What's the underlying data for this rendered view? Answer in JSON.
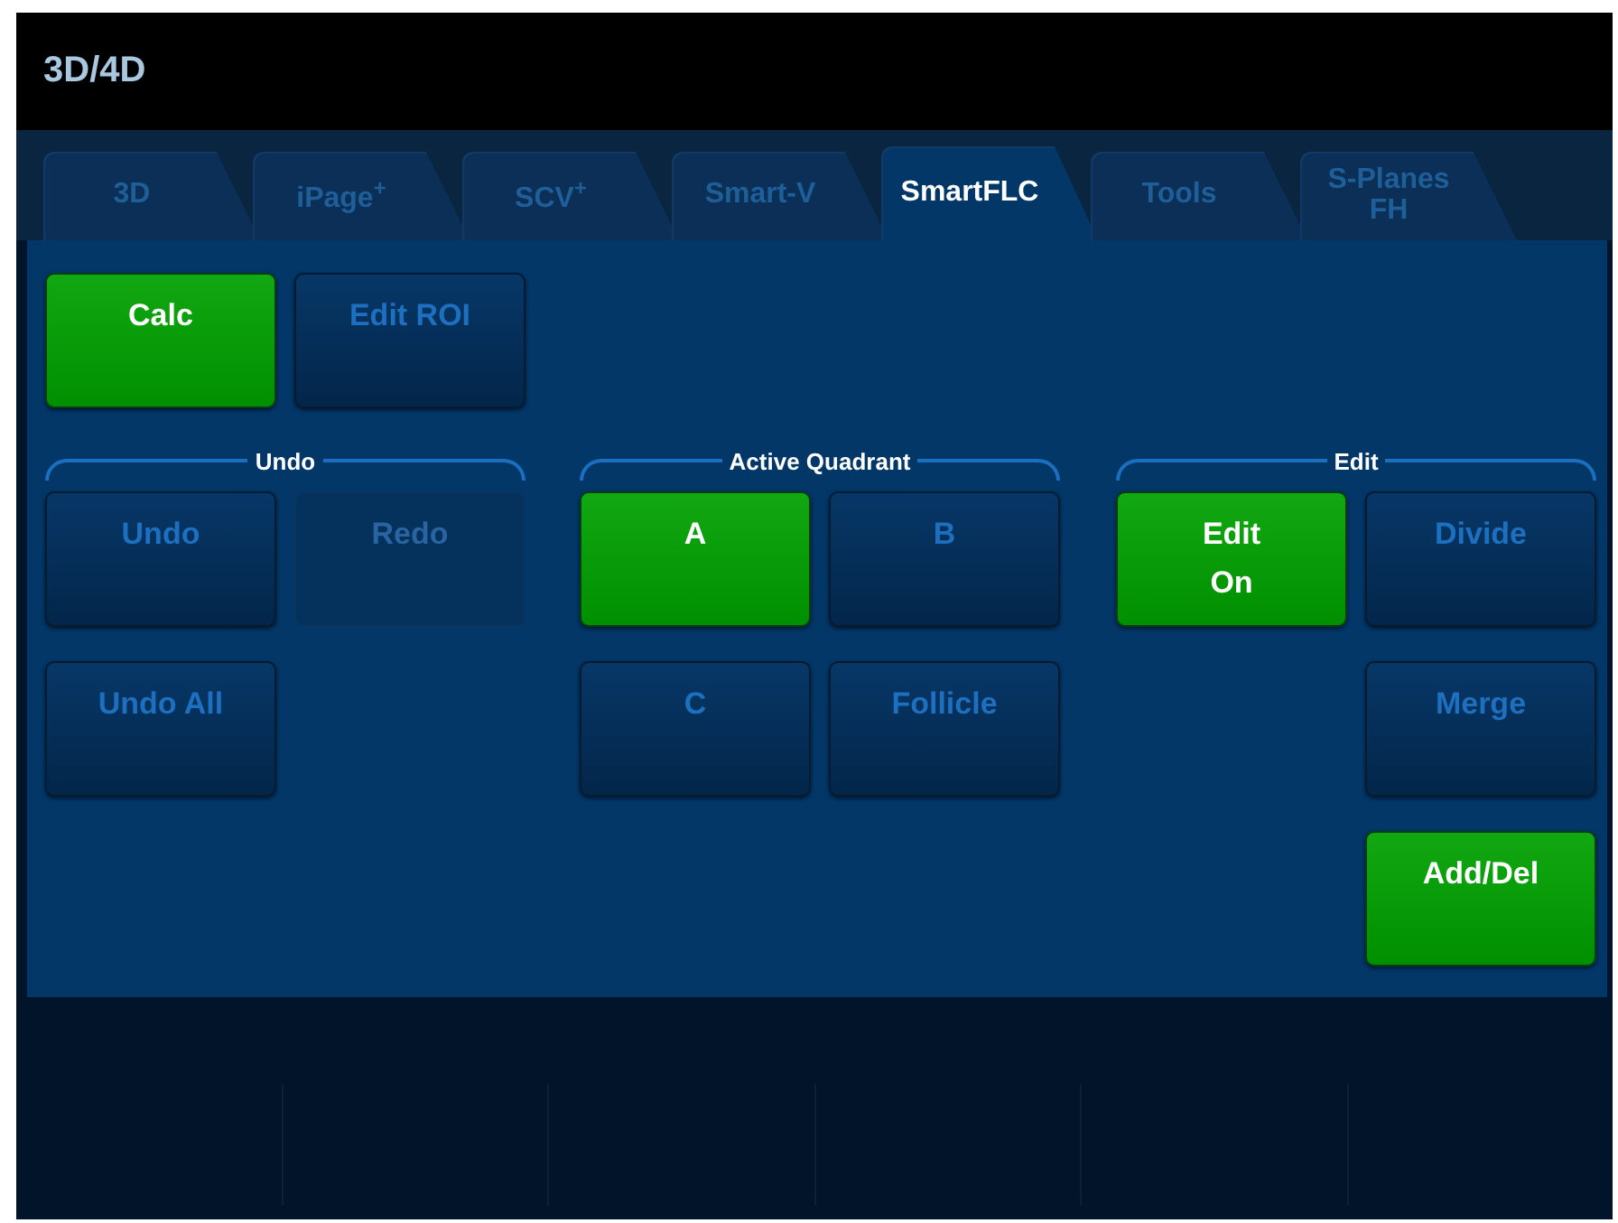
{
  "window": {
    "title": "3D/4D"
  },
  "tabs": [
    {
      "label": "3D",
      "selected": false
    },
    {
      "label": "iPage$^{+}$",
      "selected": false
    },
    {
      "label": "SCV$^{+}$",
      "selected": false
    },
    {
      "label": "Smart-V",
      "selected": false
    },
    {
      "label": "SmartFLC",
      "selected": true
    },
    {
      "label": "Tools",
      "selected": false
    },
    {
      "label": "S-Planes\nFH",
      "selected": false
    }
  ],
  "top_buttons": [
    {
      "label": "Calc",
      "on": true,
      "disabled": false
    },
    {
      "label": "Edit ROI",
      "on": false,
      "disabled": false
    }
  ],
  "groups": [
    {
      "title": "Undo",
      "items": [
        {
          "kind": "button",
          "label": "Undo",
          "on": false,
          "disabled": false
        },
        {
          "kind": "button",
          "label": "Redo",
          "on": false,
          "disabled": true
        },
        {
          "kind": "button",
          "label": "Undo All",
          "on": false,
          "disabled": false
        },
        {
          "kind": "spacer"
        }
      ]
    },
    {
      "title": "Active Quadrant",
      "items": [
        {
          "kind": "button",
          "label": "A",
          "on": true,
          "disabled": false
        },
        {
          "kind": "button",
          "label": "B",
          "on": false,
          "disabled": false
        },
        {
          "kind": "button",
          "label": "C",
          "on": false,
          "disabled": false
        },
        {
          "kind": "button",
          "label": "Follicle",
          "on": false,
          "disabled": false
        }
      ]
    },
    {
      "title": "Edit",
      "items": [
        {
          "kind": "button",
          "label": "Edit\nOn",
          "on": true,
          "disabled": false
        },
        {
          "kind": "button",
          "label": "Divide",
          "on": false,
          "disabled": false
        },
        {
          "kind": "spacer"
        },
        {
          "kind": "button",
          "label": "Merge",
          "on": false,
          "disabled": false
        },
        {
          "kind": "spacer"
        },
        {
          "kind": "button",
          "label": "Add/Del",
          "on": true,
          "disabled": false
        }
      ]
    }
  ]
}
